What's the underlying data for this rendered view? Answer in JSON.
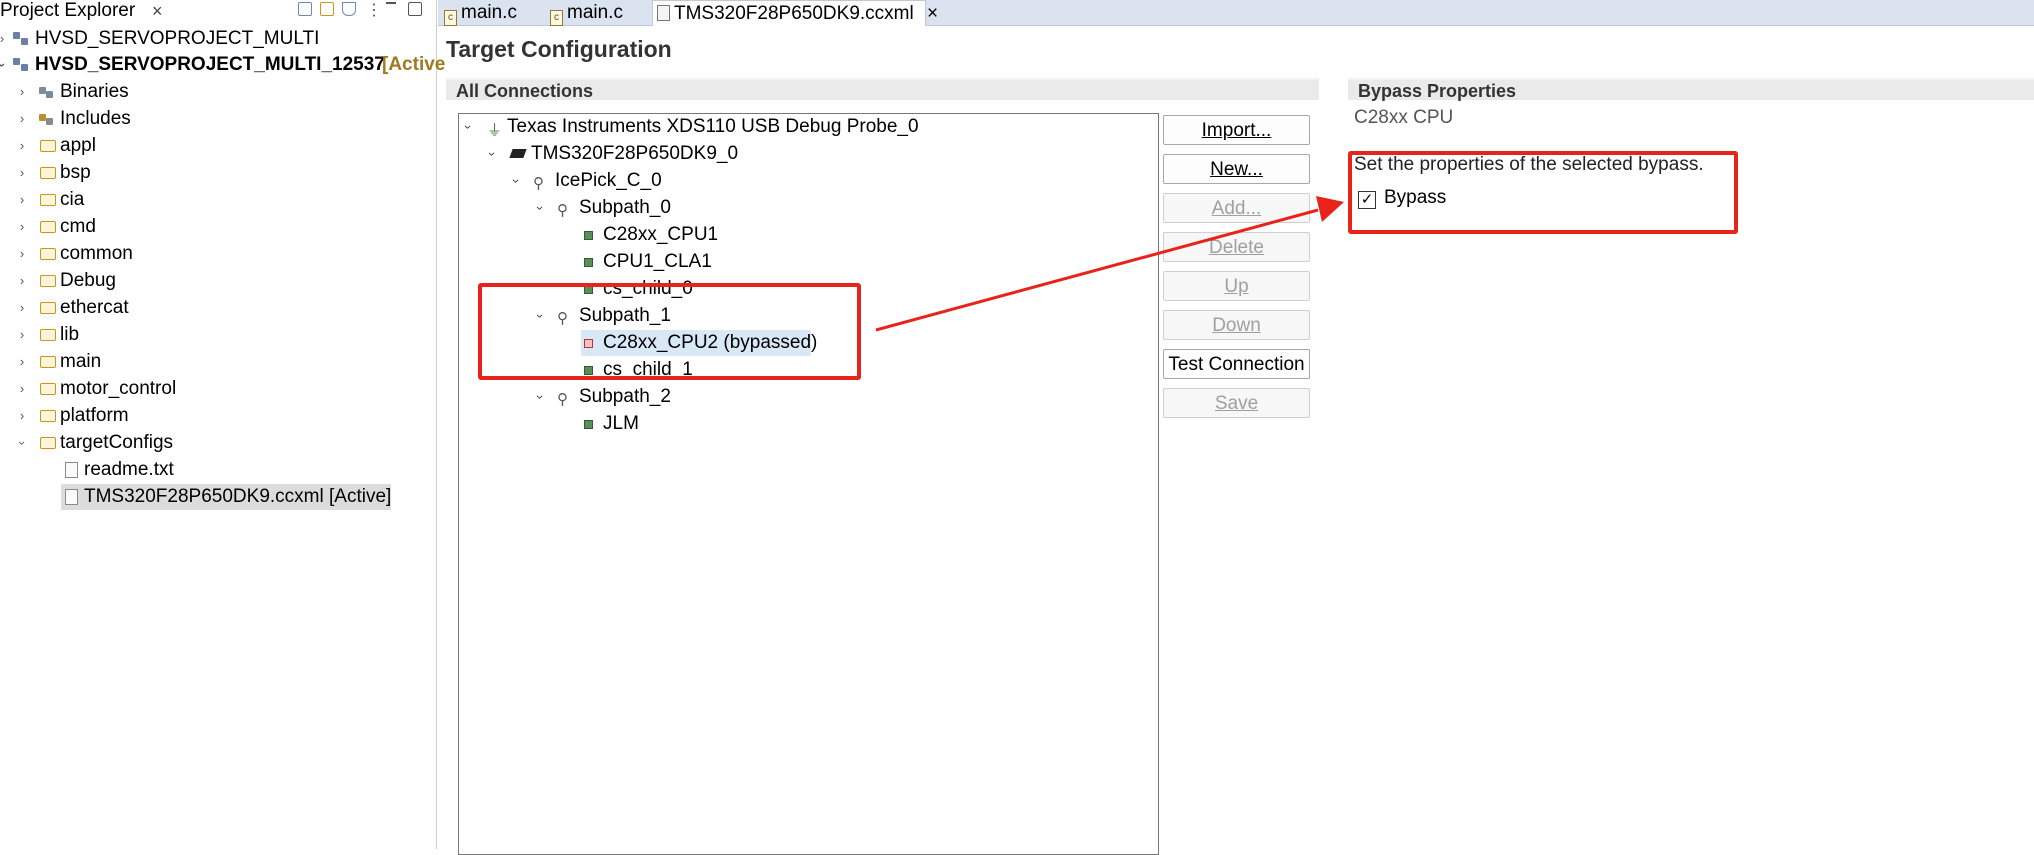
{
  "explorer": {
    "title": "Project Explorer",
    "close": "×",
    "items": [
      {
        "label": "HVSD_SERVOPROJECT_MULTI",
        "bold": false
      },
      {
        "label": "HVSD_SERVOPROJECT_MULTI_12537",
        "bold": true,
        "suffix": "[Active"
      },
      {
        "label": "Binaries"
      },
      {
        "label": "Includes"
      },
      {
        "label": "appl"
      },
      {
        "label": "bsp"
      },
      {
        "label": "cia"
      },
      {
        "label": "cmd"
      },
      {
        "label": "common"
      },
      {
        "label": "Debug"
      },
      {
        "label": "ethercat"
      },
      {
        "label": "lib"
      },
      {
        "label": "main"
      },
      {
        "label": "motor_control"
      },
      {
        "label": "platform"
      },
      {
        "label": "targetConfigs"
      },
      {
        "label": "readme.txt"
      },
      {
        "label": "TMS320F28P650DK9.ccxml [Active]"
      }
    ]
  },
  "tabs": [
    {
      "label": "main.c"
    },
    {
      "label": "main.c"
    },
    {
      "label": "TMS320F28P650DK9.ccxml",
      "close": "×"
    }
  ],
  "editor": {
    "title": "Target Configuration",
    "connections_header": "All Connections",
    "tree": [
      {
        "label": "Texas Instruments XDS110 USB Debug Probe_0"
      },
      {
        "label": "TMS320F28P650DK9_0"
      },
      {
        "label": "IcePick_C_0"
      },
      {
        "label": "Subpath_0"
      },
      {
        "label": "C28xx_CPU1"
      },
      {
        "label": "CPU1_CLA1"
      },
      {
        "label": "cs_child_0"
      },
      {
        "label": "Subpath_1"
      },
      {
        "label": "C28xx_CPU2 (bypassed)"
      },
      {
        "label": "cs_child_1"
      },
      {
        "label": "Subpath_2"
      },
      {
        "label": "JLM"
      }
    ],
    "buttons": {
      "import": "Import...",
      "new": "New...",
      "add": "Add...",
      "delete": "Delete",
      "up": "Up",
      "down": "Down",
      "test": "Test Connection",
      "save": "Save"
    }
  },
  "properties": {
    "header": "Bypass Properties",
    "subtitle": "C28xx CPU",
    "description": "Set the properties of the selected bypass.",
    "bypass_label": "Bypass",
    "bypass_checked": true,
    "check_glyph": "✓"
  },
  "colors": {
    "annotation_red": "#e8231b",
    "selection": "#d8e8f7"
  }
}
